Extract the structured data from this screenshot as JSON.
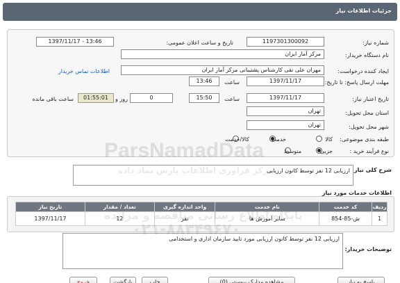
{
  "header": {
    "title": "جزئیات اطلاعات نیاز"
  },
  "fields": {
    "need_number_label": "شماره نیاز:",
    "need_number": "1197301300092",
    "announce_label": "تاریخ و ساعت اعلان عمومی:",
    "announce_value": "1397/11/17 - 13:46",
    "buyer_org_label": "نام دستگاه خریدار:",
    "buyer_org": "مرکز آمار ایران",
    "creator_label": "ایجاد کننده درخواست:",
    "creator": "مهران  علی نقی کارشناس پشتیبانی مرکز آمار ایران",
    "contact_link": "اطلاعات تماس خریدار",
    "send_deadline_label": "مهلت ارسال پاسخ: تا تاریخ:",
    "send_date": "1397/11/17",
    "time_label": "ساعت",
    "send_time": "13:46",
    "validity_label": "تاریخ اعتبار نیاز:",
    "valid_date": "1397/11/17",
    "valid_time": "15:50",
    "day_label": "روز و",
    "days": "0",
    "timer": "01:55:01",
    "remaining_label": "ساعت باقی مانده",
    "province_label": "استان محل تحویل:",
    "province": "تهران",
    "city_label": "شهر محل تحویل:",
    "city": "تهران",
    "category_label": "طبقه بندی موضوعی:",
    "category_options": [
      "کالا",
      "خدمت",
      "کالا/خدمت"
    ],
    "category_selected": "خدمت",
    "process_label": "نوع فرآیند خرید :",
    "process_options": [
      "جزیی",
      "متوسط"
    ],
    "process_selected": "جزیی"
  },
  "summary": {
    "label": "شرح کلی نیاز:",
    "value": "ارزیابی 12 نفر توسط کانون ارزیابی"
  },
  "services_title": "اطلاعات خدمات مورد نیاز",
  "table": {
    "headers": [
      "ردیف",
      "کد خدمت",
      "نام خدمت",
      "واحد اندازه گیری",
      "تعداد / مقدار",
      "تاریخ نیاز"
    ],
    "rows": [
      [
        "1",
        "ش-85-854",
        "سایر آموزش ها",
        "نفر",
        "12",
        "1397/11/17"
      ]
    ]
  },
  "buyer_notes": {
    "label": "توضیحات خریدار:",
    "value": "ارزیابی 12 نفر توسط کانون ارزیابی مورد تایید سازمان اداری و استخدامی"
  },
  "buttons": [
    "پاسخ به نیاز",
    "مشاهده مدارک پیوستی (0)",
    "چاپ",
    "بازگشت",
    "خروج"
  ],
  "watermark": {
    "brand": "ParsNamadData",
    "line1": "مرکز فراوری اطلاعات پارس نماد داده",
    "line2": "پایگاه اطلاع رسانی مناقصه و مزایده",
    "phone": "۰۲۱-۸۸۳۴۹۶۷۰"
  },
  "colors": {
    "header_bg": "#5a6674",
    "table_header_bg": "#6f7780",
    "link": "#1a5fb4",
    "timer_bg": "#e9e9c9",
    "exit_button": "#c01010"
  }
}
